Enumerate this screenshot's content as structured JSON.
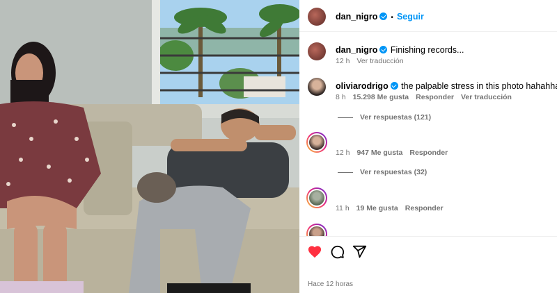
{
  "post": {
    "author": "dan_nigro",
    "follow_label": "Seguir",
    "dot": "•",
    "caption_author": "dan_nigro",
    "caption_text": "Finishing records...",
    "caption_time": "12 h",
    "caption_translate": "Ver traducción",
    "timestamp": "Hace 12 horas"
  },
  "comments": [
    {
      "user": "oliviarodrigo",
      "text": "the palpable stress in this photo hahahha",
      "time": "8 h",
      "likes": "15.298 Me gusta",
      "reply": "Responder",
      "translate": "Ver traducción",
      "view_replies": "Ver respuestas (121)"
    },
    {
      "time": "12 h",
      "likes": "947 Me gusta",
      "reply": "Responder",
      "view_replies": "Ver respuestas (32)"
    },
    {
      "time": "11 h",
      "likes": "19 Me gusta",
      "reply": "Responder"
    }
  ],
  "icons": {
    "like": "heart-icon",
    "comment": "comment-icon",
    "share": "share-icon"
  },
  "colors": {
    "link_blue": "#0095f6",
    "like_red": "#ff3040",
    "muted": "#737373"
  }
}
